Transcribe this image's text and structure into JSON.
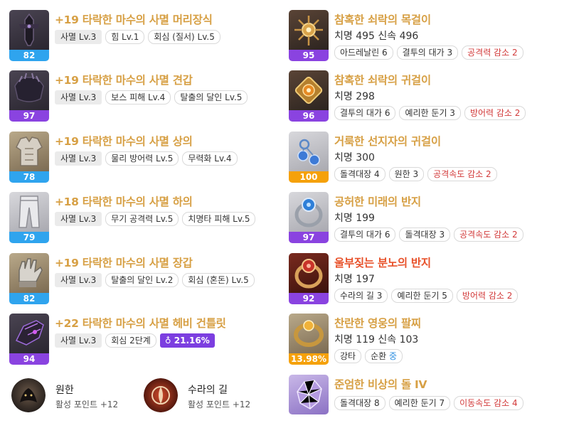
{
  "equipment": [
    {
      "level": "82",
      "quality_color": "blue",
      "name": "+19 타락한 마수의 사멸 머리장식",
      "tags": [
        "사멸 Lv.3",
        "힘 Lv.1",
        "회심 (질서) Lv.5"
      ]
    },
    {
      "level": "97",
      "quality_color": "purple",
      "name": "+19 타락한 마수의 사멸 견갑",
      "tags": [
        "사멸 Lv.3",
        "보스 피해 Lv.4",
        "탈출의 달인 Lv.5"
      ]
    },
    {
      "level": "78",
      "quality_color": "blue",
      "name": "+19 타락한 마수의 사멸 상의",
      "tags": [
        "사멸 Lv.3",
        "물리 방어력 Lv.5",
        "무력화 Lv.4"
      ]
    },
    {
      "level": "79",
      "quality_color": "blue",
      "name": "+18 타락한 마수의 사멸 하의",
      "tags": [
        "사멸 Lv.3",
        "무기 공격력 Lv.5",
        "치명타 피해 Lv.5"
      ]
    },
    {
      "level": "82",
      "quality_color": "blue",
      "name": "+19 타락한 마수의 사멸 장갑",
      "tags": [
        "사멸 Lv.3",
        "탈출의 달인 Lv.2",
        "회심 (혼돈) Lv.5"
      ]
    },
    {
      "level": "94",
      "quality_color": "purple",
      "name": "+22 타락한 마수의 사멸 헤비 건틀릿",
      "tags": [
        "사멸 Lv.3",
        "회심 2단계"
      ],
      "transcend": "21.16%"
    }
  ],
  "accessories": [
    {
      "level": "95",
      "quality_color": "purple",
      "name": "참혹한 쇠락의 목걸이",
      "stats": "치명 495  신속 496",
      "tags": [
        {
          "text": "아드레날린 6",
          "neg": false
        },
        {
          "text": "결투의 대가 3",
          "neg": false
        },
        {
          "text": "공격력 감소 2",
          "neg": true
        }
      ]
    },
    {
      "level": "96",
      "quality_color": "purple",
      "name": "참혹한 쇠락의 귀걸이",
      "stats": "치명 298",
      "tags": [
        {
          "text": "결투의 대가 6",
          "neg": false
        },
        {
          "text": "예리한 둔기 3",
          "neg": false
        },
        {
          "text": "방어력 감소 2",
          "neg": true
        }
      ]
    },
    {
      "level": "100",
      "quality_color": "orange",
      "name": "거룩한 선지자의 귀걸이",
      "stats": "치명 300",
      "tags": [
        {
          "text": "돌격대장 4",
          "neg": false
        },
        {
          "text": "원한 3",
          "neg": false
        },
        {
          "text": "공격속도 감소 2",
          "neg": true
        }
      ]
    },
    {
      "level": "97",
      "quality_color": "purple",
      "name": "공허한 미래의 반지",
      "stats": "치명 199",
      "tags": [
        {
          "text": "결투의 대가 6",
          "neg": false
        },
        {
          "text": "돌격대장 3",
          "neg": false
        },
        {
          "text": "공격속도 감소 2",
          "neg": true
        }
      ]
    },
    {
      "level": "92",
      "quality_color": "purple",
      "name": "울부짖는 분노의 반지",
      "stats": "치명 197",
      "tags": [
        {
          "text": "수라의 길 3",
          "neg": false
        },
        {
          "text": "예리한 둔기 5",
          "neg": false
        },
        {
          "text": "방어력 감소 2",
          "neg": true
        }
      ]
    },
    {
      "level": "13.98%",
      "quality_color": "orange",
      "name": "찬란한 영웅의 팔찌",
      "stats": "치명 119  신속 103",
      "tags": [
        {
          "text": "강타",
          "neg": false
        }
      ],
      "tag_prefix": "순환 ",
      "tag_highlight": "중"
    },
    {
      "level": "",
      "quality_color": "",
      "name": "준엄한 비상의 돌 IV",
      "stats": "",
      "tags": [
        {
          "text": "돌격대장 8",
          "neg": false
        },
        {
          "text": "예리한 둔기 7",
          "neg": false
        },
        {
          "text": "이동속도 감소 4",
          "neg": true
        }
      ]
    }
  ],
  "engravings": [
    {
      "name": "원한",
      "points": "활성 포인트 +12"
    },
    {
      "name": "수라의 길",
      "points": "활성 포인트 +12"
    }
  ],
  "colors": {
    "blue": "#2fa4ee",
    "purple": "#8a43e0",
    "orange": "#f5a10a",
    "gold_title": "#d7a045",
    "relic_title": "#e8532c",
    "negative": "#d23a3a"
  }
}
